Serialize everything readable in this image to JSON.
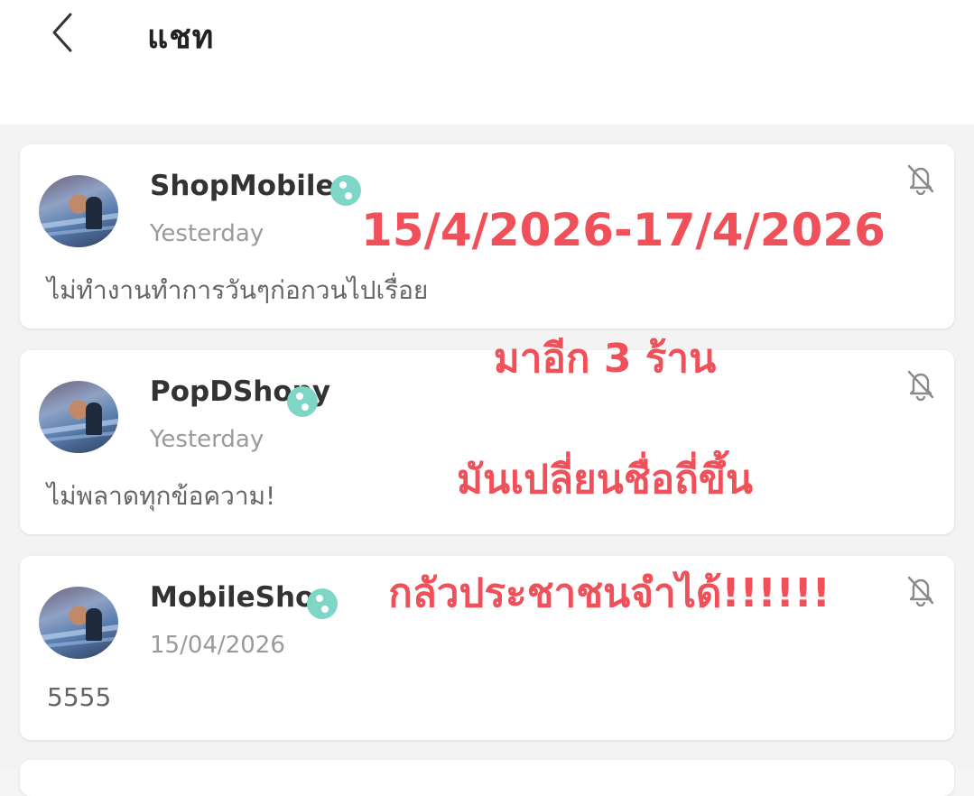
{
  "header": {
    "title": "แชท",
    "back_icon": "chevron-left-icon"
  },
  "colors": {
    "overlay_text": "#f0505a",
    "badge": "#7ed6c6",
    "background": "#f3f3f3"
  },
  "chats": [
    {
      "shop_name": "ShopMobilec",
      "time": "Yesterday",
      "message": "ไม่ทำงานทำการวันๆก่อกวนไปเรื่อย",
      "badge_icon": "verified-badge-icon",
      "mute_icon": "bell-off-icon"
    },
    {
      "shop_name": "PopDShopy",
      "time": "Yesterday",
      "message": "ไม่พลาดทุกข้อความ!",
      "badge_icon": "verified-badge-icon",
      "mute_icon": "bell-off-icon"
    },
    {
      "shop_name": "MobileShop",
      "time": "15/04/2026",
      "message": "5555",
      "badge_icon": "verified-badge-icon",
      "mute_icon": "bell-off-icon"
    }
  ],
  "overlay": {
    "date_range": "15/4/2026-17/4/2026",
    "line2": "มาอีก 3 ร้าน",
    "line3": "มันเปลี่ยนชื่อถี่ขึ้น",
    "line4": "กลัวประชาชนจำได้!!!!!!"
  }
}
